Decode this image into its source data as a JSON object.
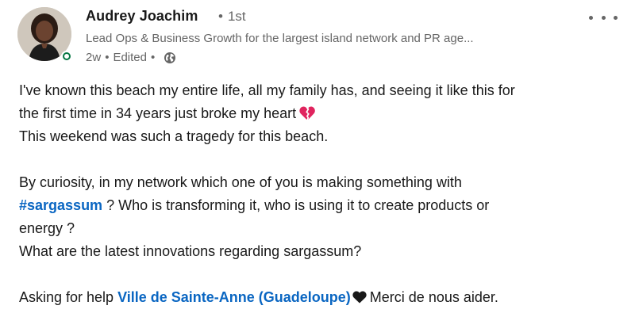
{
  "author": {
    "name": "Audrey Joachim",
    "degree": "1st",
    "headline": "Lead Ops & Business Growth for the largest island network and PR age...",
    "time": "2w",
    "edited": "Edited",
    "presence_color": "#057642",
    "visibility_icon": "globe-icon"
  },
  "menu": {
    "icon": "more-options-icon"
  },
  "post": {
    "p1_line1": "I've known this beach my entire life, all my family has, and seeing it like this for",
    "p1_line2": "the first time in 34 years just broke my heart",
    "p1_line2_emoji": "broken-heart-icon",
    "p1_line3": "This weekend was such a tragedy for this beach.",
    "p2_line1": "By curiosity, in my network which one of you is making something with",
    "hashtag": "#sargassum",
    "p2_line2_rest": " ? Who is transforming it, who is using it to create products or",
    "p2_line3": "energy ?",
    "p2_line4": "What are the latest innovations regarding sargassum?",
    "p3_prefix": "Asking for help ",
    "mention": "Ville de Sainte-Anne (Guadeloupe)",
    "p3_emoji": "black-heart-icon",
    "p3_suffix": "Merci de nous aider."
  },
  "colors": {
    "link": "#0a66c2",
    "text": "#191919",
    "secondary": "#666666",
    "broken_heart": "#e0245e"
  }
}
